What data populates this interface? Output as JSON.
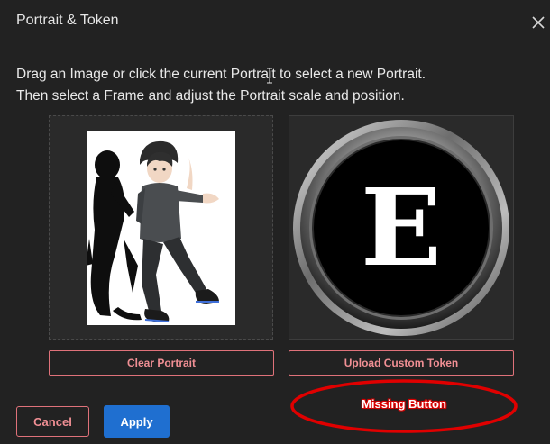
{
  "dialog": {
    "title": "Portrait & Token",
    "close_icon": "close-icon"
  },
  "instructions": {
    "line1": "Drag an Image or click the current Portrait to select a new Portrait.",
    "line2": "Then select a Frame and adjust the Portrait scale and position."
  },
  "portrait": {
    "image_icon": "anime-character-portrait"
  },
  "token": {
    "letter": "E",
    "frame_icon": "metallic-ring-frame"
  },
  "buttons": {
    "clear_portrait": "Clear Portrait",
    "upload_custom_token": "Upload Custom Token",
    "cancel": "Cancel",
    "apply": "Apply"
  },
  "annotation": {
    "label": "Missing Button",
    "color": "#e00000"
  },
  "colors": {
    "background": "#222222",
    "accent_outline": "#e0727a",
    "apply_blue": "#1f6fd0"
  }
}
